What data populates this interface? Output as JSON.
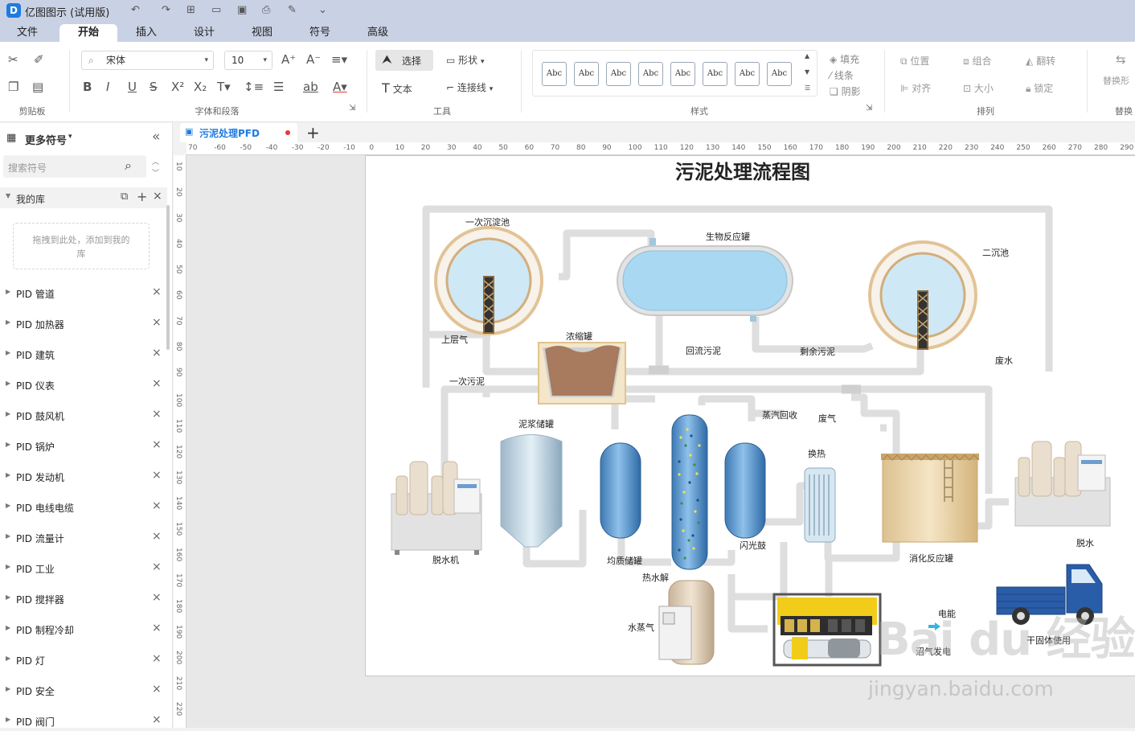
{
  "app": {
    "logo": "D",
    "title": "亿图图示 (试用版)"
  },
  "quick_access": {
    "undo": "↶",
    "redo": "↷",
    "new": "⊞",
    "open": "▭",
    "save": "▣",
    "print": "⎙",
    "export": "✎",
    "more": "⌄"
  },
  "menu_tabs": [
    "文件",
    "开始",
    "插入",
    "设计",
    "视图",
    "符号",
    "高级"
  ],
  "active_tab": "开始",
  "ribbon": {
    "font_name": "宋体",
    "font_size": "10",
    "select_label": "选择",
    "shape_label": "形状",
    "text_label": "文本",
    "connector_label": "连接线",
    "fill_label": "填充",
    "line_label": "线条",
    "shadow_label": "阴影",
    "position_label": "位置",
    "group_label": "组合",
    "flip_label": "翻转",
    "align_label": "对齐",
    "size_label": "大小",
    "lock_label": "锁定",
    "replace_shape_label": "替换形",
    "style_thumb": "Abc",
    "group_clipboard": "剪贴板",
    "group_font": "字体和段落",
    "group_tools": "工具",
    "group_style": "样式",
    "group_arrange": "排列",
    "group_replace": "替换"
  },
  "sidebar": {
    "header": "更多符号",
    "search_placeholder": "搜索符号",
    "my_library": "我的库",
    "drop_hint": "拖拽到此处，添加到我的库",
    "libraries": [
      "PID 管道",
      "PID 加热器",
      "PID 建筑",
      "PID 仪表",
      "PID 鼓风机",
      "PID 锅炉",
      "PID 发动机",
      "PID 电线电缆",
      "PID 流量计",
      "PID 工业",
      "PID 搅拌器",
      "PID 制程冷却",
      "PID 灯",
      "PID 安全",
      "PID 阀门"
    ]
  },
  "document": {
    "tab_name": "污泥处理PFD",
    "add_tab": "+"
  },
  "ruler_h": [
    "70",
    "-60",
    "-50",
    "-40",
    "-30",
    "-20",
    "-10",
    "0",
    "10",
    "20",
    "30",
    "40",
    "50",
    "60",
    "70",
    "80",
    "90",
    "100",
    "110",
    "120",
    "130",
    "140",
    "150",
    "160",
    "170",
    "180",
    "190",
    "200",
    "210",
    "220",
    "230",
    "240",
    "250",
    "260",
    "270",
    "280",
    "290"
  ],
  "ruler_v": [
    "10",
    "20",
    "30",
    "40",
    "50",
    "60",
    "70",
    "80",
    "90",
    "100",
    "110",
    "120",
    "130",
    "140",
    "150",
    "160",
    "170",
    "180",
    "190",
    "200",
    "210",
    "220"
  ],
  "diagram": {
    "title": "污泥处理流程图",
    "labels": {
      "primary_settling": "一次沉淀池",
      "bioreactor": "生物反应罐",
      "secondary_settling": "二沉池",
      "upper_gas": "上层气",
      "thickener": "浓缩罐",
      "return_sludge": "回流污泥",
      "excess_sludge": "剩余污泥",
      "waste_water": "废水",
      "primary_sludge": "一次污泥",
      "slurry_storage": "泥浆储罐",
      "steam_recovery": "蒸汽回收",
      "waste_gas": "废气",
      "heat_exchange": "换热",
      "dewatering_machine": "脱水机",
      "homogenize_tank": "均质储罐",
      "flash_drum": "闪光鼓",
      "digester": "消化反应罐",
      "dewater": "脱水",
      "thermal_hydrolysis": "热水解",
      "steam": "水蒸气",
      "electricity": "电能",
      "biogas_gen": "沼气发电",
      "solid_use": "干固体使用"
    }
  },
  "watermark": {
    "brand": "Bai du 经验",
    "url": "jingyan.baidu.com"
  },
  "colors": {
    "accent": "#1e7be0",
    "titlebar": "#c9d1e4",
    "pipe": "#dcdcdc",
    "tank_blue": "#5b9bd5",
    "water": "#bfe3f6"
  }
}
